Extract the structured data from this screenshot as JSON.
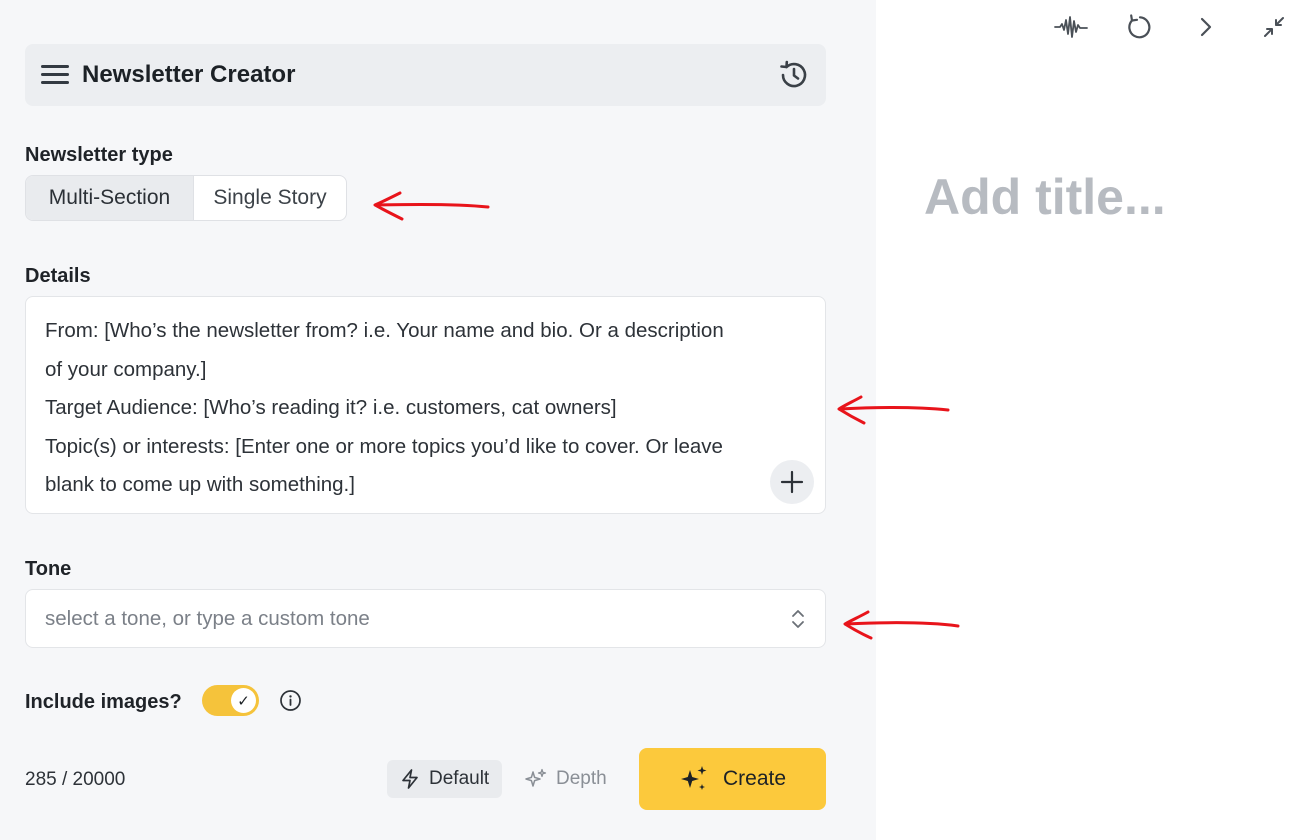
{
  "header": {
    "title": "Newsletter Creator"
  },
  "newsletter_type": {
    "label": "Newsletter type",
    "options": [
      "Multi-Section",
      "Single Story"
    ],
    "selected": "Multi-Section"
  },
  "details": {
    "label": "Details",
    "lines": [
      "From: [Who’s the newsletter from? i.e. Your name and bio. Or a description",
      "of your company.]",
      "Target Audience: [Who’s reading it? i.e. customers, cat owners]",
      "Topic(s) or interests: [Enter one or more topics you’d like to cover. Or leave",
      "blank to come up with something.]"
    ]
  },
  "tone": {
    "label": "Tone",
    "placeholder": "select a tone, or type a custom tone",
    "value": ""
  },
  "include_images": {
    "label": "Include images?",
    "enabled": true,
    "check": "✓"
  },
  "footer": {
    "char_count": "285 / 20000",
    "mode_default": "Default",
    "mode_depth": "Depth",
    "create_label": "Create"
  },
  "editor": {
    "title_placeholder": "Add title..."
  },
  "icons": {
    "menu": "hamburger-icon",
    "history": "history-icon",
    "plus": "plus-icon",
    "chevrons": "chevron-up-down-icon",
    "info": "info-icon",
    "default_mode": "lightning-icon",
    "depth_mode": "sparkles-icon",
    "create": "sparkles-icon",
    "toolbar": [
      "waveform-icon",
      "refresh-icon",
      "chevron-right-icon",
      "collapse-icon"
    ]
  },
  "colors": {
    "accent": "#fcc93c",
    "toggle_on": "#f5c33b",
    "annotation_arrow": "#e8141b",
    "placeholder_title": "#b7bbc1"
  }
}
